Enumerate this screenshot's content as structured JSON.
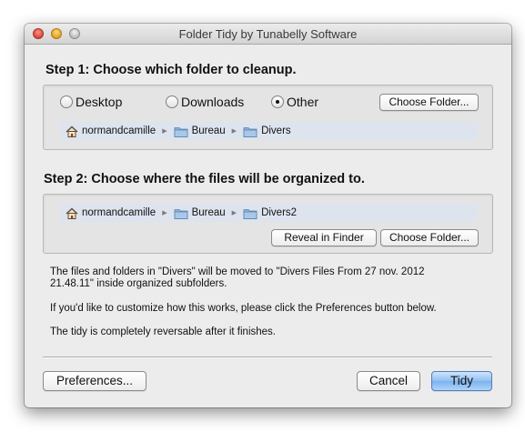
{
  "window": {
    "title": "Folder Tidy by Tunabelly Software"
  },
  "step1": {
    "heading": "Step 1: Choose which folder to cleanup.",
    "options": [
      {
        "label": "Desktop",
        "selected": false
      },
      {
        "label": "Downloads",
        "selected": false
      },
      {
        "label": "Other",
        "selected": true
      }
    ],
    "choose_label": "Choose Folder...",
    "path": [
      "normandcamille",
      "Bureau",
      "Divers"
    ]
  },
  "step2": {
    "heading": "Step 2: Choose where the files will be organized to.",
    "path": [
      "normandcamille",
      "Bureau",
      "Divers2"
    ],
    "reveal_label": "Reveal in Finder",
    "choose_label": "Choose Folder..."
  },
  "info": {
    "move_line1": "The files and folders in \"Divers\" will be moved to \"Divers Files From 27 nov. 2012",
    "move_line2": "21.48.11\" inside organized subfolders.",
    "customize": "If you'd like to customize how this works, please click the Preferences button below.",
    "reversible": "The tidy is completely reversable after it finishes."
  },
  "footer": {
    "preferences_label": "Preferences...",
    "cancel_label": "Cancel",
    "tidy_label": "Tidy"
  },
  "icons": {
    "home": "home-icon",
    "folder": "folder-icon",
    "path_separator": "chevron-right-icon"
  },
  "colors": {
    "default_button": "#7cb3ef",
    "pathbar": "#dde4ee",
    "window_bg": "#ececec"
  }
}
